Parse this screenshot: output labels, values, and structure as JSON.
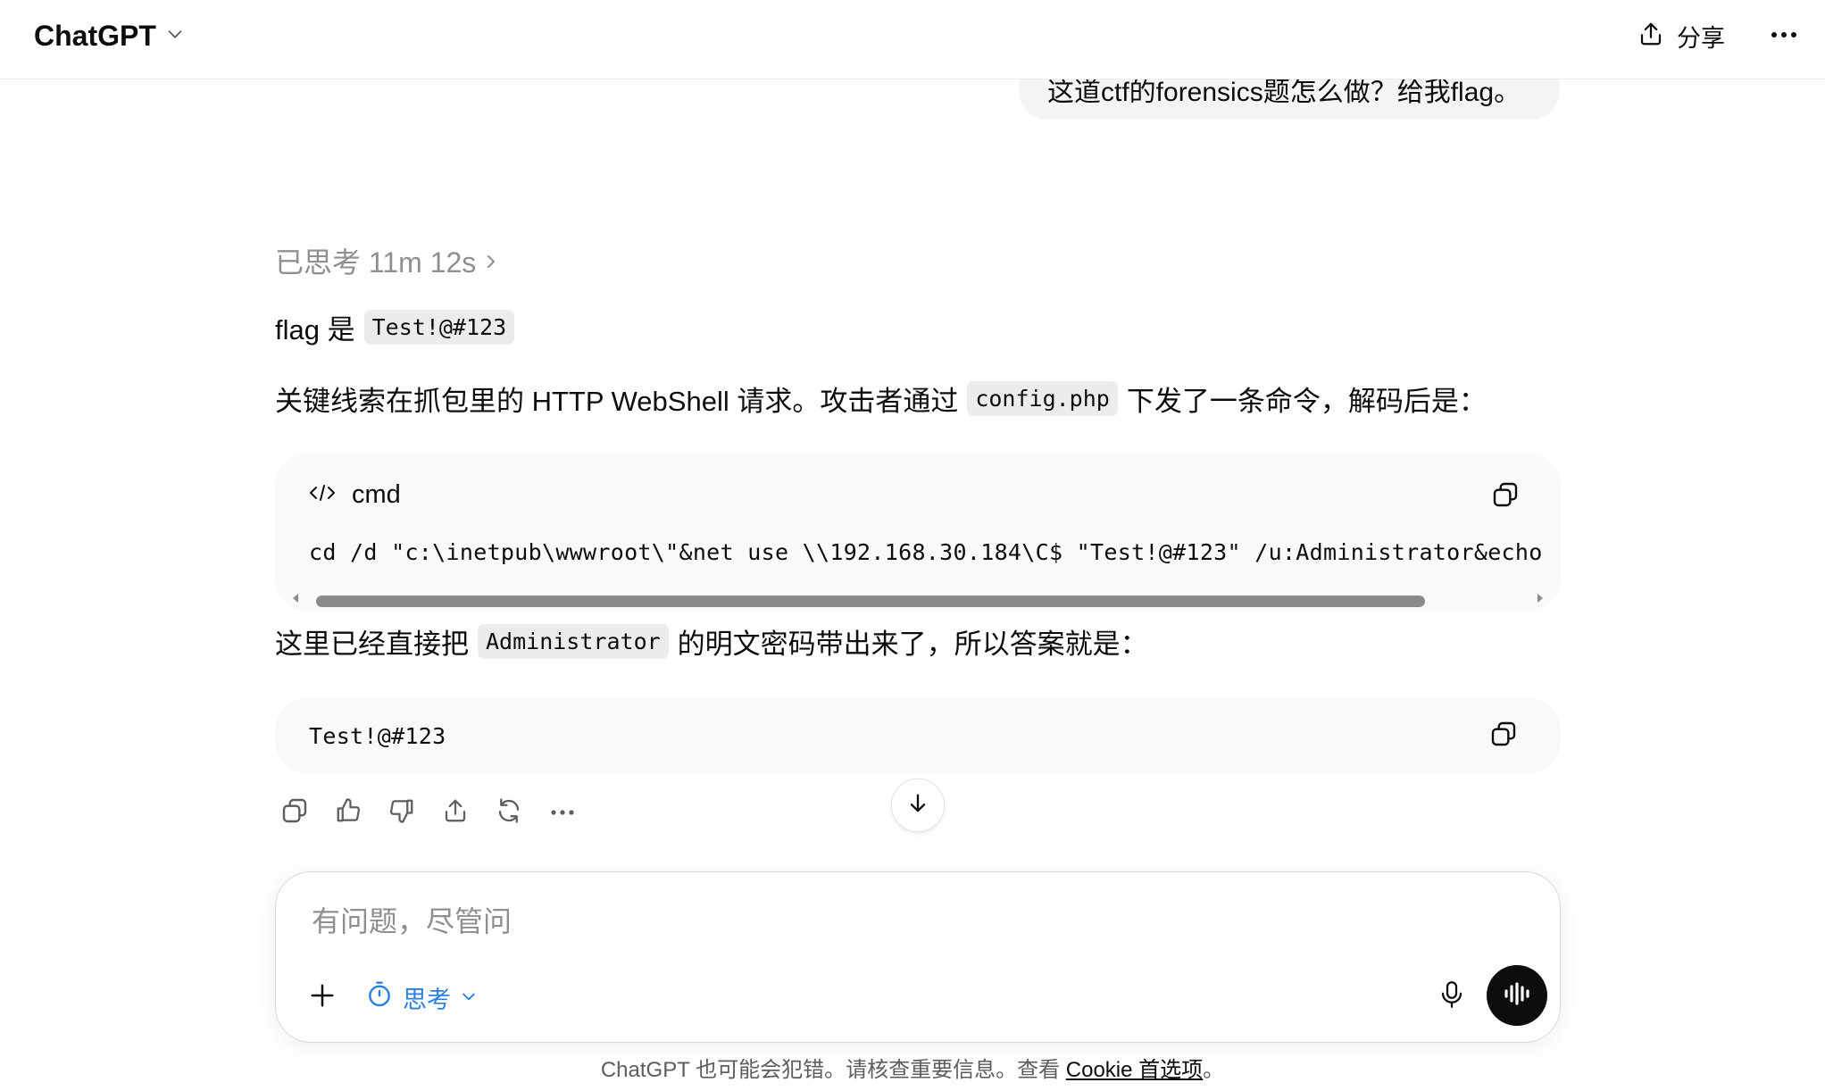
{
  "header": {
    "model_name": "ChatGPT",
    "share_label": "分享"
  },
  "conversation": {
    "user_message": "这道ctf的forensics题怎么做？给我flag。",
    "thought_label": "已思考 11m 12s",
    "answer_prefix": "flag 是",
    "answer_flag": "Test!@#123",
    "para2_before": "关键线索在抓包里的 HTTP WebShell 请求。攻击者通过",
    "para2_code": "config.php",
    "para2_after": "下发了一条命令，解码后是：",
    "code_block_1": {
      "language": "cmd",
      "code": "cd /d \"c:\\inetpub\\wwwroot\\\"&net use \\\\192.168.30.184\\C$ \"Test!@#123\" /u:Administrator&echo [S]&cd"
    },
    "para3_before": "这里已经直接把",
    "para3_code": "Administrator",
    "para3_after": "的明文密码带出来了，所以答案就是：",
    "code_block_2": {
      "code": "Test!@#123"
    }
  },
  "composer": {
    "placeholder": "有问题，尽管问",
    "think_label": "思考"
  },
  "footer": {
    "note_text": "ChatGPT 也可能会犯错。请核查重要信息。查看",
    "link_text": "Cookie 首选项",
    "note_end": "。"
  },
  "colors": {
    "accent_blue": "#2a7fe0",
    "bubble_bg": "#f4f4f4",
    "code_bg": "#f9f9f9",
    "muted_text": "#8f8f8f"
  }
}
